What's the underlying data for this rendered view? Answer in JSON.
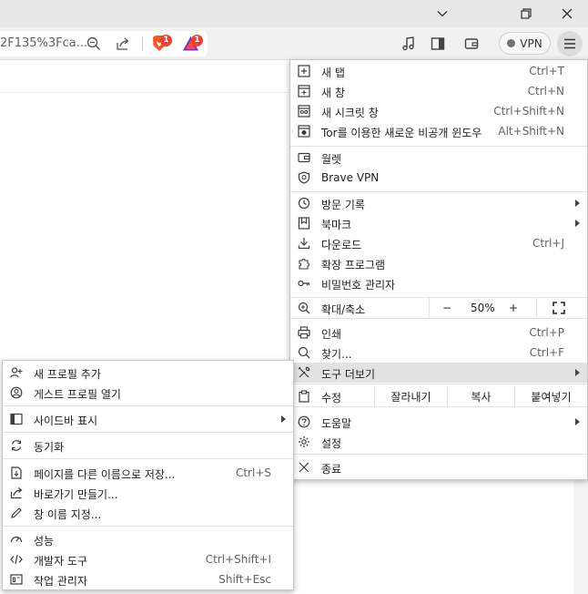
{
  "toolbar": {
    "url_text": "2F135%3Fca...",
    "shields_badge": "1",
    "rewards_badge": "1",
    "vpn_label": "VPN"
  },
  "main_menu": {
    "new_tab": {
      "label": "새 탭",
      "shortcut": "Ctrl+T"
    },
    "new_window": {
      "label": "새 창",
      "shortcut": "Ctrl+N"
    },
    "new_incognito": {
      "label": "새 시크릿 창",
      "shortcut": "Ctrl+Shift+N"
    },
    "new_tor": {
      "label": "Tor를 이용한 새로운 비공개 윈도우",
      "shortcut": "Alt+Shift+N"
    },
    "wallet": {
      "label": "월렛"
    },
    "vpn": {
      "label": "Brave VPN"
    },
    "history": {
      "label": "방문 기록"
    },
    "bookmarks": {
      "label": "북마크"
    },
    "downloads": {
      "label": "다운로드",
      "shortcut": "Ctrl+J"
    },
    "extensions": {
      "label": "확장 프로그램"
    },
    "passwords": {
      "label": "비밀번호 관리자"
    },
    "zoom": {
      "label": "확대/축소",
      "minus": "−",
      "value": "50%",
      "plus": "+"
    },
    "print": {
      "label": "인쇄",
      "shortcut": "Ctrl+P"
    },
    "find": {
      "label": "찾기...",
      "shortcut": "Ctrl+F"
    },
    "more_tools": {
      "label": "도구 더보기"
    },
    "edit": {
      "label": "수정",
      "cut": "잘라내기",
      "copy": "복사",
      "paste": "붙여넣기"
    },
    "help": {
      "label": "도움말"
    },
    "settings": {
      "label": "설정"
    },
    "exit": {
      "label": "종료"
    }
  },
  "sub_menu": {
    "add_profile": {
      "label": "새 프로필 추가"
    },
    "guest_profile": {
      "label": "게스트 프로필 열기"
    },
    "sidebar": {
      "label": "사이드바 표시"
    },
    "sync": {
      "label": "동기화"
    },
    "save_page": {
      "label": "페이지를 다른 이름으로 저장...",
      "shortcut": "Ctrl+S"
    },
    "create_shortcut": {
      "label": "바로가기 만들기..."
    },
    "name_window": {
      "label": "창 이름 지정..."
    },
    "performance": {
      "label": "성능"
    },
    "dev_tools": {
      "label": "개발자 도구",
      "shortcut": "Ctrl+Shift+I"
    },
    "task_manager": {
      "label": "작업 관리자",
      "shortcut": "Shift+Esc"
    }
  },
  "colors": {
    "highlight": "#e2e2e2",
    "badge": "#ea4335",
    "brave_orange": "#fb542b"
  }
}
